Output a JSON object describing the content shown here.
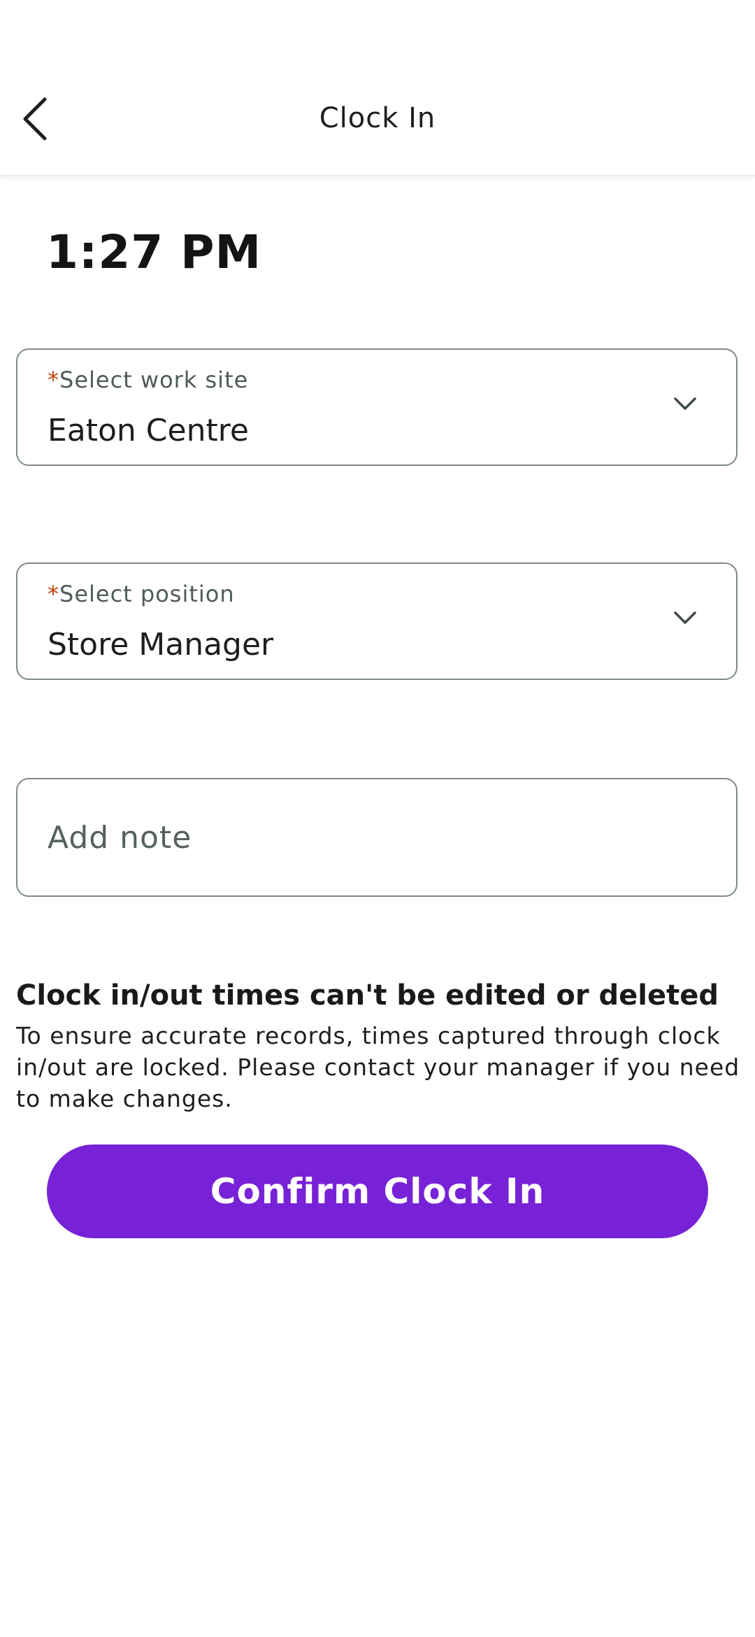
{
  "header": {
    "title": "Clock In",
    "back_icon": "chevron-left-icon"
  },
  "clock": {
    "time": "1:27 PM"
  },
  "work_site": {
    "required_mark": "*",
    "label": "Select work site",
    "value": "Eaton Centre",
    "icon": "chevron-down-icon"
  },
  "position": {
    "required_mark": "*",
    "label": "Select position",
    "value": "Store Manager",
    "icon": "chevron-down-icon"
  },
  "note": {
    "placeholder": "Add note",
    "value": ""
  },
  "notice": {
    "title": "Clock in/out times can't be edited or deleted",
    "body": "To ensure accurate records, times captured through clock in/out are locked. Please contact your manager if you need to make changes."
  },
  "actions": {
    "confirm_label": "Confirm Clock In"
  },
  "colors": {
    "accent": "#7722d6",
    "required": "#c2410c",
    "border": "#7e8a8a"
  }
}
